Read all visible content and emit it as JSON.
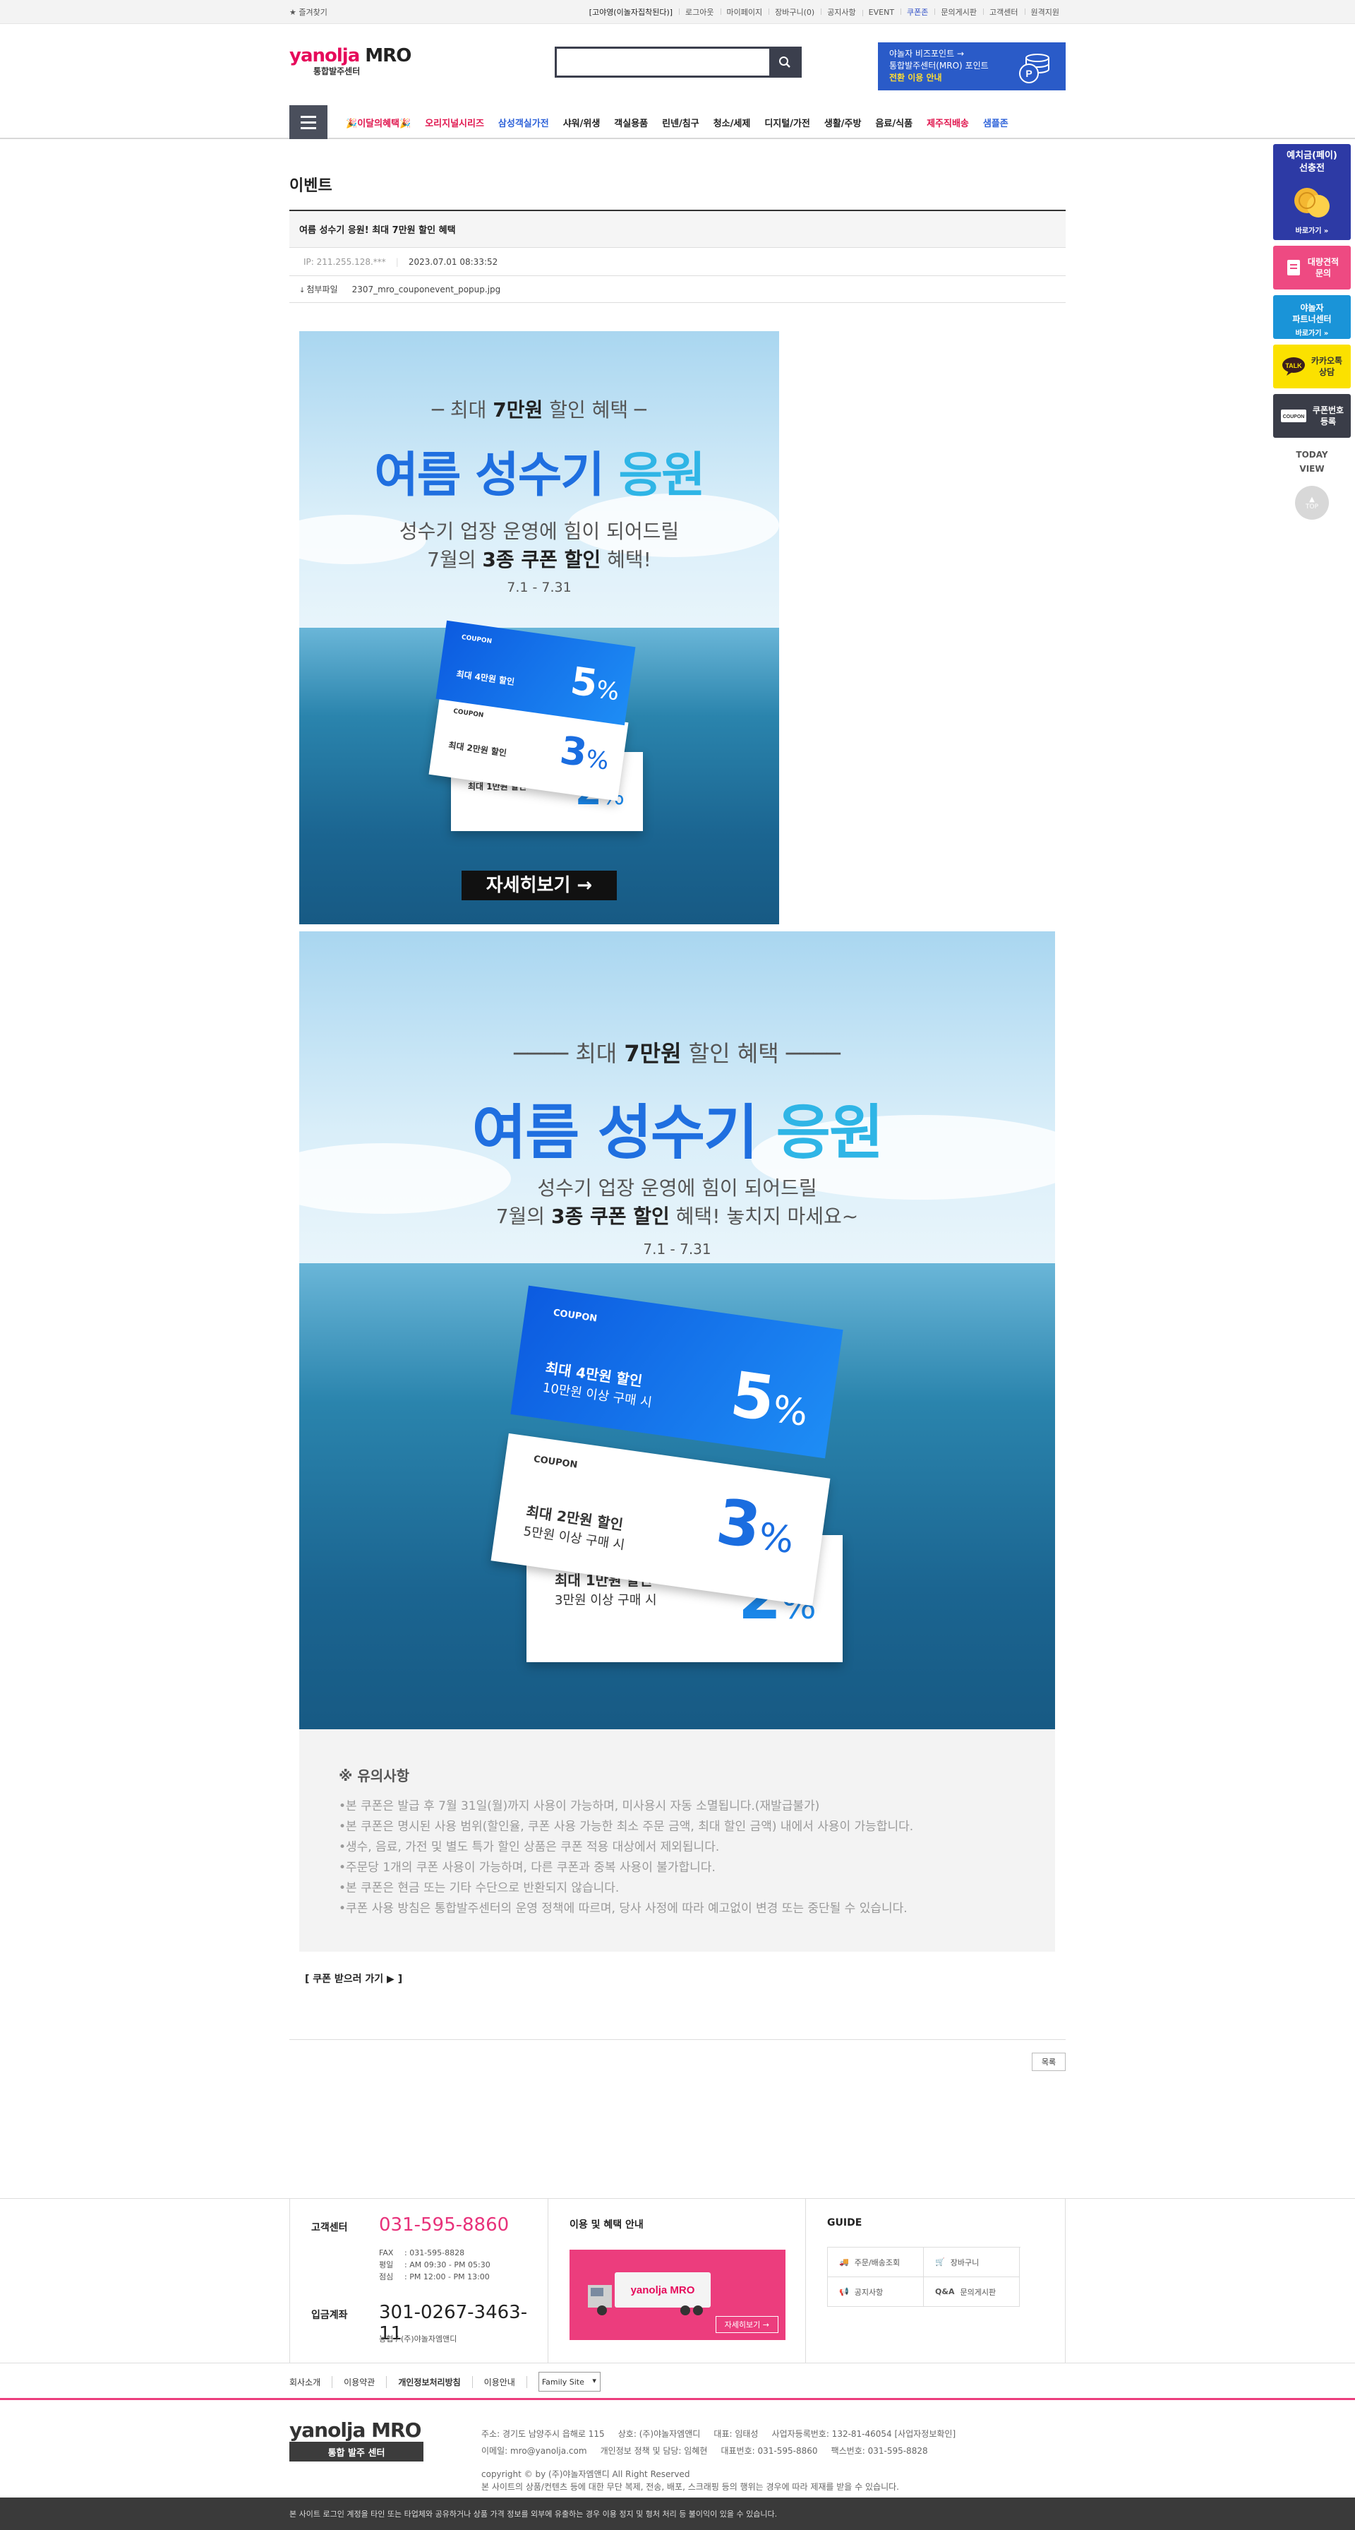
{
  "topbar": {
    "favorite": "★ 즐겨찾기",
    "links": [
      "[고야영(이놀자집착된다)]",
      "로그아웃",
      "마이페이지",
      "장바구니(0)",
      "공지사항",
      "EVENT",
      "쿠폰존",
      "문의게시판",
      "고객센터",
      "원격지원"
    ]
  },
  "header": {
    "logo_main_a": "yanolja",
    "logo_main_b": "MRO",
    "logo_sub": "통합발주센터",
    "search_placeholder": "",
    "biz": {
      "line1": "야놀자 비즈포인트 →",
      "line2": "통합발주센터(MRO) 포인트",
      "line3": "전환 이용 안내"
    }
  },
  "gnb": {
    "items": [
      {
        "label": "이달의혜택",
        "color": "#e0174f"
      },
      {
        "label": "오리지널시리즈",
        "color": "#e0174f"
      },
      {
        "label": "삼성객실가전",
        "color": "#2f63d9"
      },
      {
        "label": "샤워/위생",
        "color": "#222222"
      },
      {
        "label": "객실용품",
        "color": "#222222"
      },
      {
        "label": "린넨/침구",
        "color": "#222222"
      },
      {
        "label": "청소/세제",
        "color": "#222222"
      },
      {
        "label": "디지털/가전",
        "color": "#222222"
      },
      {
        "label": "생활/주방",
        "color": "#222222"
      },
      {
        "label": "음료/식품",
        "color": "#222222"
      },
      {
        "label": "제주직배송",
        "color": "#e0174f"
      },
      {
        "label": "샘플존",
        "color": "#2f63d9"
      }
    ]
  },
  "quick": {
    "deposit": {
      "title": "예치금(페이)\n선충전",
      "sub": "바로가기 »"
    },
    "estimate": "대량견적\n문의",
    "partner": {
      "title": "야놀자\n파트너센터",
      "sub": "바로가기 »"
    },
    "kakao": "카카오톡\n상담",
    "coupon": "쿠폰번호\n등록",
    "today": "TODAY\nVIEW",
    "top": "TOP"
  },
  "post": {
    "section_title": "이벤트",
    "title": "여름 성수기 응원! 최대 7만원 할인 혜택",
    "ip": "IP: 211.255.128.***",
    "date": "2023.07.01 08:33:52",
    "file_label": "첨부파일",
    "file_name": "2307_mro_couponevent_popup.jpg"
  },
  "banner": {
    "headline_pre": "최대",
    "headline_bold": "7만원",
    "headline_post": "할인 혜택",
    "title_a": "여름 성수기",
    "title_b": "응원",
    "sub1": "성수기 업장 운영에 힘이 되어드릴",
    "sub2_pre": "7월의",
    "sub2_bold": "3종 쿠폰 할인",
    "sub2_post_short": "혜택!",
    "sub2_post_long": "혜택! 놓치지 마세요~",
    "period": "7.1 - 7.31",
    "coupons": [
      {
        "tag": "COUPON",
        "label": "최대 4만원 할인",
        "cond": "10만원 이상 구매 시",
        "pct": "5",
        "unit": "%"
      },
      {
        "tag": "COUPON",
        "label": "최대 2만원 할인",
        "cond": "5만원 이상 구매 시",
        "pct": "3",
        "unit": "%"
      },
      {
        "tag": "",
        "label": "최대 1만원 할인",
        "cond": "3만원 이상 구매 시",
        "pct": "2",
        "unit": "%"
      }
    ],
    "cta": "자세히보기 →"
  },
  "notice": {
    "title": "※ 유의사항",
    "items": [
      "본 쿠폰은 발급 후 7월 31일(월)까지 사용이 가능하며, 미사용시 자동 소멸됩니다.(재발급불가)",
      "본 쿠폰은 명시된 사용 범위(할인율, 쿠폰 사용 가능한 최소 주문 금액, 최대 할인 금액) 내에서 사용이 가능합니다.",
      "생수, 음료, 가전 및 별도 특가 할인 상품은 쿠폰 적용 대상에서 제외됩니다.",
      "주문당 1개의 쿠폰 사용이 가능하며, 다른 쿠폰과 중복 사용이 불가합니다.",
      "본 쿠폰은 현금 또는 기타 수단으로 반환되지 않습니다.",
      "쿠폰 사용 방침은 통합발주센터의 운영 정책에 따르며, 당사 사정에 따라 예고없이 변경 또는 중단될 수 있습니다."
    ]
  },
  "coupon_link": "[ 쿠폰 받으러 가기 ▶ ]",
  "list_button": "목록",
  "footer": {
    "cs_title": "고객센터",
    "cs_tel": "031-595-8860",
    "fax_label": "FAX",
    "fax": ": 031-595-8828",
    "weekday_label": "평일",
    "weekday": ": AM 09:30 - PM 05:30",
    "lunch_label": "점심",
    "lunch": ": PM 12:00 - PM 13:00",
    "acct_title": "입금계좌",
    "acct": "301-0267-3463-11",
    "acct_owner": "농협 / (주)야놀자엠앤디",
    "benefit_title": "이용 및 혜택 안내",
    "benefit_btn": "자세히보기 →",
    "truck_logo": "yanolja MRO",
    "guide_title": "GUIDE",
    "guide_items": [
      "주문/배송조회",
      "장바구니",
      "공지사항",
      "문의게시판"
    ],
    "guide_qna": "Q&A",
    "nav": [
      "회사소개",
      "이용약관",
      "개인정보처리방침",
      "이용안내"
    ],
    "family": "Family Site",
    "logo_a": "yanolja",
    "logo_b": "MRO",
    "logo_tag": "통합 발주 센터",
    "addr1": "주소: 경기도 남양주시 읍해로 115     상호: (주)야놀자엠앤디     대표: 임태성     사업자등록번호: 132-81-46054 [사업자정보확인]",
    "addr2": "이메일: mro@yanolja.com     개인정보 정책 및 담당: 임혜현     대표번호: 031-595-8860     팩스번호: 031-595-8828",
    "copy1": "copyright © by (주)야놀자엠앤디 All Right Reserved",
    "copy2": "본 사이트의 상품/컨텐츠 등에 대한 무단 복제, 전송, 배포, 스크래핑 등의 행위는 경우에 따라 제재를 받을 수 있습니다.",
    "bottom": "본 사이트 로그인 계정을 타인 또는 타업체와 공유하거나 상품 가격 정보를 외부에 유출하는 경우 이용 정지 및 형처 처리 등 불이익이 있을 수 있습니다."
  },
  "colors": {
    "brand_pink": "#e60a5b",
    "brand_blue": "#1f6fe0",
    "nav_dark": "#4a4f5c"
  }
}
